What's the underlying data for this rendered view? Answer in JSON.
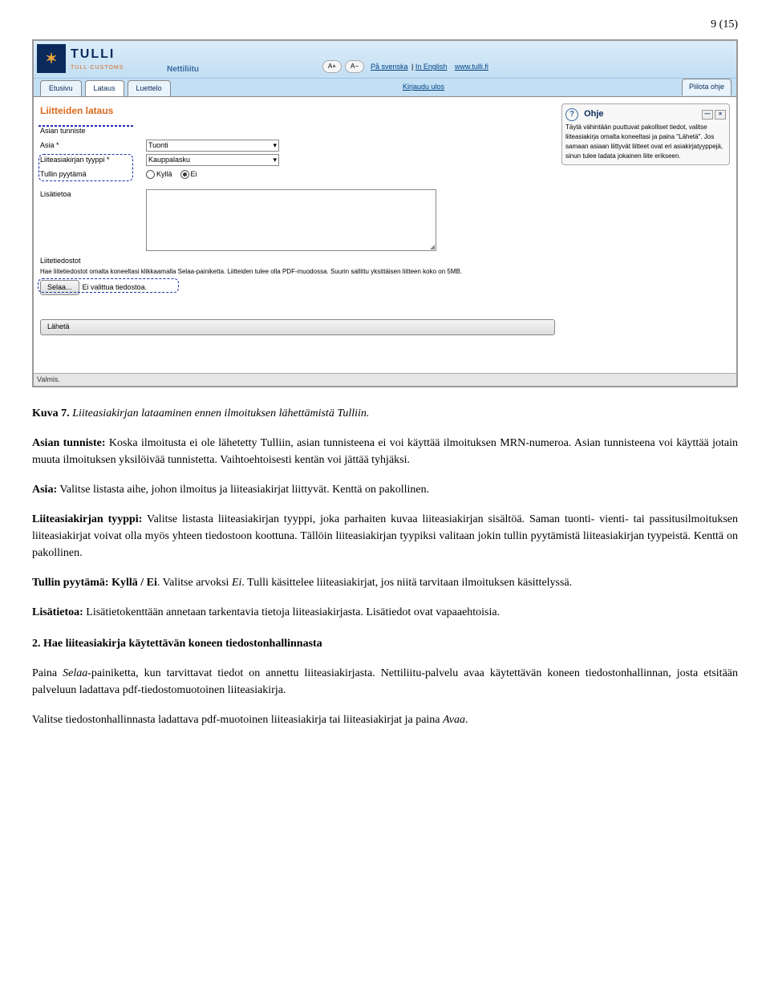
{
  "page_number": "9 (15)",
  "screenshot": {
    "logo_main": "TULLI",
    "logo_sub": "TULL·CUSTOMS",
    "brand": "Nettiliitu",
    "font_plus": "A+",
    "font_minus": "A−",
    "link_sv": "På svenska",
    "link_en": "In English",
    "link_url": "www.tulli.fi",
    "logout": "Kirjaudu ulos",
    "tabs": {
      "etusivu": "Etusivu",
      "lataus": "Lataus",
      "luettelo": "Luettelo"
    },
    "hide_help": "Piilota ohje",
    "form_title": "Liitteiden lataus",
    "labels": {
      "asian_tunniste": "Asian tunniste",
      "asia": "Asia *",
      "tyyppi": "Liiteasiakirjan tyyppi *",
      "tullin_pyytama": "Tullin pyytämä",
      "lisatietoa": "Lisätietoa"
    },
    "values": {
      "asia": "Tuonti",
      "tyyppi": "Kauppalasku",
      "kylla": "Kyllä",
      "ei": "Ei"
    },
    "file_section_title": "Liitetiedostot",
    "file_section_help": "Hae liitetiedostot omalta koneeltasi klikkaamalla Selaa-painiketta. Liitteiden tulee olla PDF-muodossa. Suurin sallittu yksittäisen liitteen koko on 5MB.",
    "browse_button": "Selaa...",
    "no_file": "Ei valittua tiedostoa.",
    "submit": "Lähetä",
    "help_title": "Ohje",
    "help_text": "Täytä vähintään puuttuvat pakolliset tiedot, valitse liiteasiakirja omalta koneeltasi ja paina \"Lähetä\". Jos samaan asiaan liittyvät liitteet ovat eri asiakirjatyyppejä, sinun tulee ladata jokainen liite erikseen.",
    "status": "Valmis."
  },
  "caption": {
    "lead": "Kuva 7.",
    "text": " Liiteasiakirjan lataaminen ennen ilmoituksen lähettämistä Tulliin."
  },
  "body": {
    "p1_lead": "Asian tunniste:",
    "p1_text": " Koska ilmoitusta ei ole lähetetty Tulliin, asian tunnisteena ei voi käyttää ilmoituksen MRN-numeroa. Asian tunnisteena voi käyttää jotain muuta ilmoituksen yksilöivää tunnistetta. Vaihtoehtoisesti kentän voi jättää tyhjäksi.",
    "p2_lead": "Asia:",
    "p2_text": " Valitse listasta aihe, johon ilmoitus ja liiteasiakirjat liittyvät. Kenttä on pakollinen.",
    "p3_lead": "Liiteasiakirjan tyyppi:",
    "p3_text": " Valitse listasta liiteasiakirjan tyyppi, joka parhaiten kuvaa liiteasiakirjan sisältöä. Saman tuonti- vienti- tai passitusilmoituksen liiteasiakirjat voivat olla myös yhteen tiedostoon koottuna. Tällöin liiteasiakirjan tyypiksi valitaan jokin tullin pyytämistä liiteasiakirjan tyypeistä. Kenttä on pakollinen.",
    "p4_lead": "Tullin pyytämä: Kyllä / Ei",
    "p4_mid": ". Valitse arvoksi ",
    "p4_italic": "Ei",
    "p4_end": ". Tulli käsittelee liiteasiakirjat, jos niitä tarvitaan ilmoituksen käsittelyssä.",
    "p5_lead": "Lisätietoa:",
    "p5_text": " Lisätietokenttään annetaan tarkentavia tietoja liiteasiakirjasta. Lisätiedot ovat vapaaehtoisia.",
    "h3": "2. Hae liiteasiakirja käytettävän koneen tiedostonhallinnasta",
    "p6_pre": "Paina ",
    "p6_italic": "Selaa",
    "p6_text": "-painiketta, kun tarvittavat tiedot on annettu liiteasiakirjasta. Nettiliitu-palvelu avaa käytettävän koneen tiedostonhallinnan, josta etsitään palveluun ladattava pdf-tiedostomuotoinen liiteasiakirja.",
    "p7_pre": "Valitse tiedostonhallinnasta ladattava pdf-muotoinen liiteasiakirja tai liiteasiakirjat ja paina ",
    "p7_italic": "Avaa",
    "p7_end": "."
  }
}
